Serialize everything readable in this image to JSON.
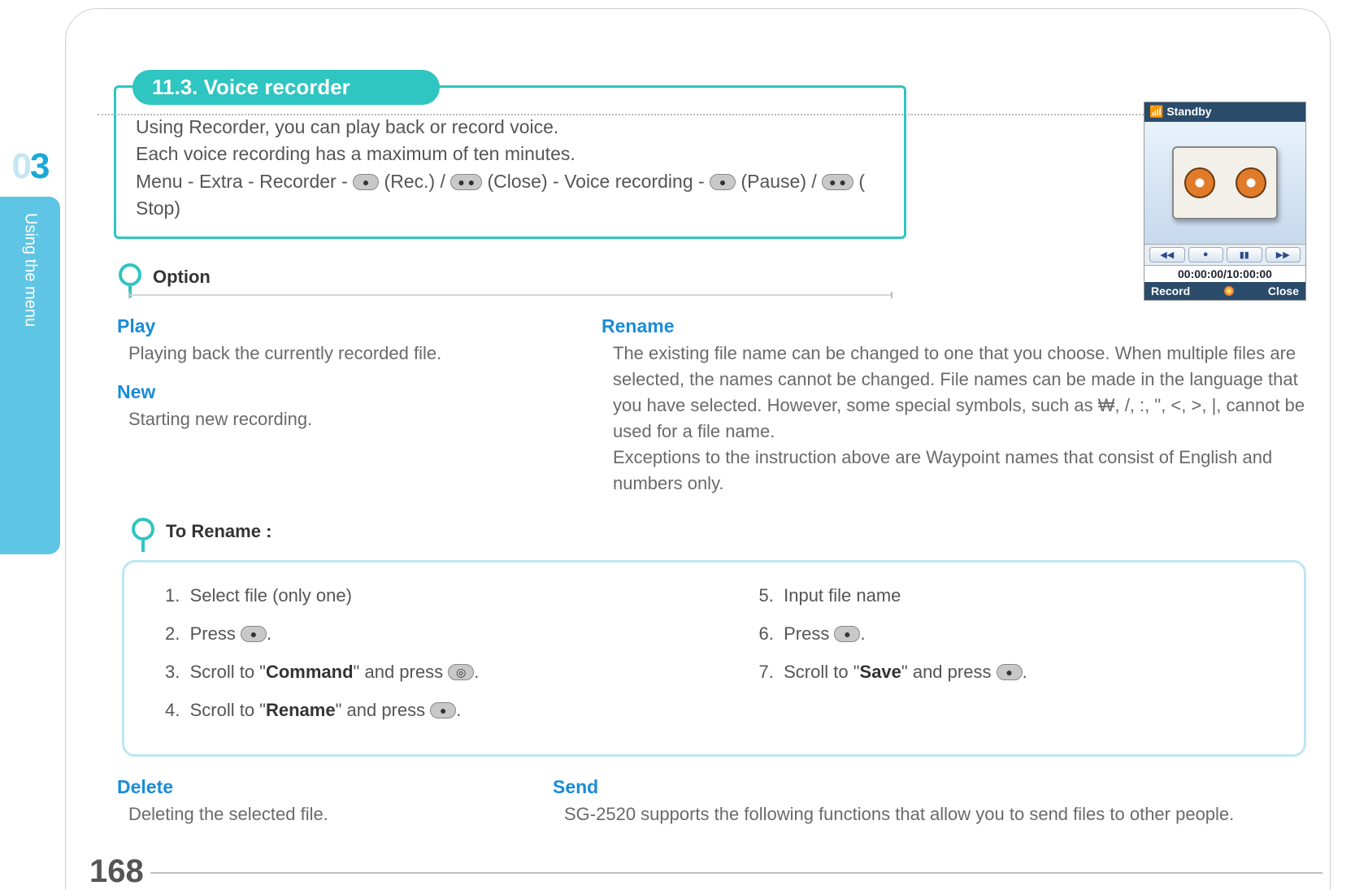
{
  "chapter": {
    "number_full": "03",
    "label": "Using the menu"
  },
  "page_number": "168",
  "section": {
    "title": "11.3. Voice recorder",
    "intro_line1": "Using Recorder, you can play back or record voice.",
    "intro_line2": "Each voice recording has a maximum of ten minutes.",
    "intro_line3a": "Menu - Extra - Recorder - ",
    "intro_rec": " (Rec.) / ",
    "intro_close": " (Close) - Voice recording - ",
    "intro_pause": " (Pause) / ",
    "intro_stop": " ( Stop)"
  },
  "phone": {
    "status": "Standby",
    "controls": {
      "rew": "◀◀",
      "rec": "●",
      "pause": "▮▮",
      "fwd": "▶▶"
    },
    "time": "00:00:00/10:00:00",
    "left_sk": "Record",
    "right_sk": "Close"
  },
  "option_heading": "Option",
  "play": {
    "title": "Play",
    "body": "Playing back the currently recorded file."
  },
  "new_": {
    "title": "New",
    "body": "Starting new recording."
  },
  "rename": {
    "title": "Rename",
    "body": "The existing file name can be changed to one that you choose. When multiple files are selected, the names cannot be changed. File names can be made in the language that you have selected.  However, some special symbols, such as ₩, /, :, \", <, >, |, cannot be used for a file name.\nExceptions to the instruction above are Waypoint names that consist of English and numbers only."
  },
  "to_rename_heading": "To Rename :",
  "steps": {
    "s1": "Select file (only one)",
    "s2a": "Press ",
    "s2b": ".",
    "s3a": "Scroll to \"",
    "s3b": "Command",
    "s3c": "\" and press ",
    "s3d": ".",
    "s4a": "Scroll to \"",
    "s4b": "Rename",
    "s4c": "\" and press ",
    "s4d": ".",
    "s5": "Input file name",
    "s6a": "Press ",
    "s6b": ".",
    "s7a": "Scroll to \"",
    "s7b": "Save",
    "s7c": "\" and press ",
    "s7d": "."
  },
  "delete": {
    "title": "Delete",
    "body": "Deleting the selected file."
  },
  "send": {
    "title": "Send",
    "body": "SG-2520 supports the following functions that allow you to send files to other people."
  },
  "icons": {
    "left_dot": "●",
    "right_dots": "● ●",
    "ok": "◎"
  }
}
